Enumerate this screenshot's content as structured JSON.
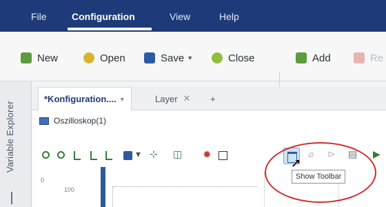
{
  "menubar": {
    "items": [
      {
        "label": "File",
        "active": false
      },
      {
        "label": "Configuration",
        "active": true
      },
      {
        "label": "View",
        "active": false
      },
      {
        "label": "Help",
        "active": false
      }
    ]
  },
  "ribbon": {
    "new_label": "New",
    "open_label": "Open",
    "save_label": "Save",
    "close_label": "Close",
    "add_label": "Add",
    "remove_label": "Re"
  },
  "side_panel": {
    "label": "Variable Explorer"
  },
  "tabs": [
    {
      "label": "*Konfiguration....",
      "active": true
    },
    {
      "label": "Layer",
      "active": false
    }
  ],
  "tab_add_label": "+",
  "document": {
    "oszi_label": "Oszilloskop(1)"
  },
  "tooltip": {
    "text": "Show Toolbar"
  },
  "plot": {
    "tick_labels": [
      "0",
      "100"
    ]
  },
  "colors": {
    "menubar_bg": "#1e3a78",
    "annotation": "#d42a2a",
    "accent": "#2c5aa0"
  },
  "icons": {
    "new": "new-file-icon",
    "open": "open-folder-icon",
    "save": "save-disk-icon",
    "close": "close-document-icon",
    "add": "add-item-icon",
    "remove": "remove-item-icon",
    "show_toolbar": "show-toolbar-icon"
  }
}
